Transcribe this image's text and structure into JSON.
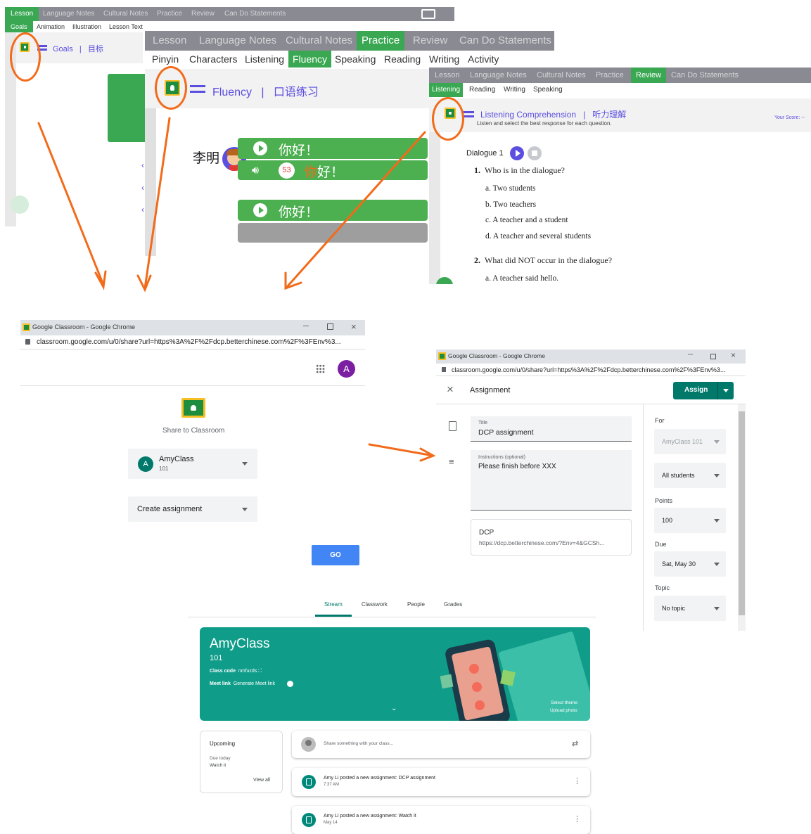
{
  "win1": {
    "nav": [
      "Lesson",
      "Language Notes",
      "Cultural Notes",
      "Practice",
      "Review",
      "Can Do Statements"
    ],
    "subnav": [
      "Goals",
      "Animation",
      "Illustration",
      "Lesson Text"
    ],
    "title": "Goals",
    "sep": "|",
    "title_cn": "目标"
  },
  "win2": {
    "nav": [
      "Lesson",
      "Language Notes",
      "Cultural Notes",
      "Practice",
      "Review",
      "Can Do Statements"
    ],
    "subnav": [
      "Pinyin",
      "Characters",
      "Listening",
      "Fluency",
      "Speaking",
      "Reading",
      "Writing",
      "Activity"
    ],
    "title": "Fluency",
    "sep": "|",
    "title_cn": "口语练习",
    "speaker": "李明",
    "line1": "你好！",
    "count": "53",
    "line2_hl": "你",
    "line2_rest": "好！",
    "line3": "你好！"
  },
  "win3": {
    "nav": [
      "Lesson",
      "Language Notes",
      "Cultural Notes",
      "Practice",
      "Review",
      "Can Do Statements"
    ],
    "subnav": [
      "Listening",
      "Reading",
      "Writing",
      "Speaking"
    ],
    "title": "Listening Comprehension",
    "sep": "|",
    "title_cn": "听力理解",
    "instructions": "Listen and select the best response for each question.",
    "score": "Your Score: --",
    "dialogue": "Dialogue 1",
    "q1": {
      "num": "1.",
      "text": "Who is in the dialogue?",
      "options": [
        "a. Two students",
        "b. Two teachers",
        "c. A teacher and a student",
        "d. A teacher and several students"
      ]
    },
    "q2": {
      "num": "2.",
      "text": "What did NOT occur in the dialogue?",
      "options": [
        "a. A teacher said hello."
      ]
    }
  },
  "share": {
    "window_title": "Google Classroom - Google Chrome",
    "url": "classroom.google.com/u/0/share?url=https%3A%2F%2Fdcp.betterchinese.com%2F%3FEnv%3...",
    "avatar": "A",
    "heading": "Share to Classroom",
    "class_name": "AmyClass",
    "class_section": "101",
    "action": "Create assignment",
    "go": "GO"
  },
  "assign": {
    "window_title": "Google Classroom - Google Chrome",
    "url": "classroom.google.com/u/0/share?url=https%3A%2F%2Fdcp.betterchinese.com%2F%3FEnv%3...",
    "header": "Assignment",
    "assign_btn": "Assign",
    "title_label": "Title",
    "title_value": "DCP assignment",
    "instr_label": "Instructions (optional)",
    "instr_value": "Please finish before XXX",
    "attach_title": "DCP",
    "attach_url": "https://dcp.betterchinese.com/?Env=4&GCSh...",
    "for_label": "For",
    "for_class": "AmyClass 101",
    "students": "All students",
    "points_label": "Points",
    "points": "100",
    "due_label": "Due",
    "due": "Sat, May 30",
    "topic_label": "Topic",
    "topic": "No topic"
  },
  "stream": {
    "tabs": [
      "Stream",
      "Classwork",
      "People",
      "Grades"
    ],
    "class_name": "AmyClass",
    "section": "101",
    "code_label": "Class code",
    "code": "nmfuzds",
    "meet_label": "Meet link",
    "meet": "Generate Meet link",
    "select_theme": "Select theme",
    "upload_photo": "Upload photo",
    "upcoming": "Upcoming",
    "due_today": "Due today",
    "watch_it": "Watch it",
    "view_all": "View all",
    "share_placeholder": "Share something with your class...",
    "post1": "Amy Li posted a new assignment: DCP assignment",
    "post1_time": "7:37 AM",
    "post2": "Amy Li posted a new assignment: Watch it",
    "post2_time": "May 14"
  },
  "colors": {
    "arrow": "#f26b1a",
    "green": "#4caf50",
    "teal": "#0f9d8a",
    "gc_green": "#1e8e3e",
    "blue": "#4285f4",
    "purple": "#5b4ee0"
  }
}
